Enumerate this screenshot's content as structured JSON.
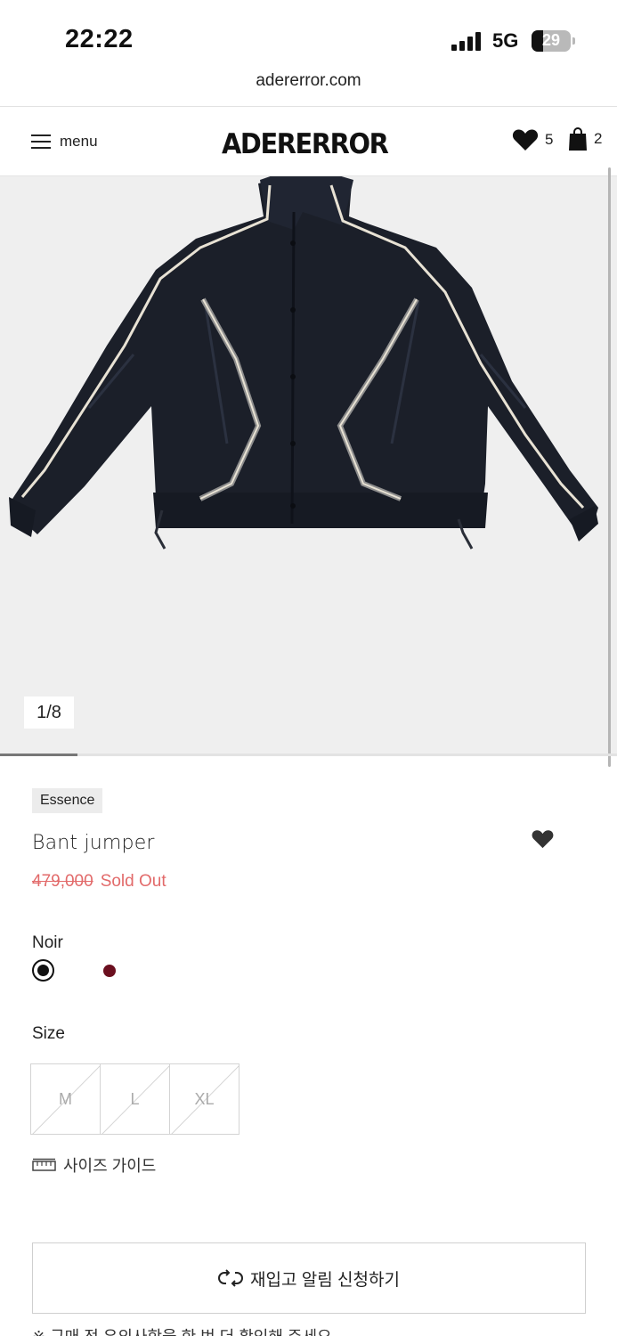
{
  "status_bar": {
    "time": "22:22",
    "network": "5G",
    "battery": "29",
    "battery_level_percent": 29
  },
  "browser": {
    "url": "adererror.com"
  },
  "header": {
    "menu_label": "menu",
    "logo": "ADERERROR",
    "wishlist_count": "5",
    "cart_count": "2"
  },
  "gallery": {
    "counter": "1/8",
    "image_alt_icon": "jacket-image",
    "progress_fraction": 0.125
  },
  "product": {
    "collection": "Essence",
    "name": "Bant jumper",
    "price": "479,000",
    "status": "Sold Out",
    "color_label": "Noir",
    "colors": [
      {
        "name": "Noir",
        "hex": "#111111",
        "selected": true
      },
      {
        "name": "",
        "hex": "#6b0f1f",
        "selected": false
      }
    ],
    "size_label": "Size",
    "sizes": [
      "M",
      "L",
      "XL"
    ],
    "size_guide": "사이즈 가이드",
    "restock_button": "재입고 알림 신청하기",
    "notice": "※ 구매 전 유의사항을 한 번 더 확인해 주세요."
  },
  "colors": {
    "price_red": "#e26a6a",
    "badge_bg": "#ececec",
    "gallery_bg": "#efefef"
  }
}
